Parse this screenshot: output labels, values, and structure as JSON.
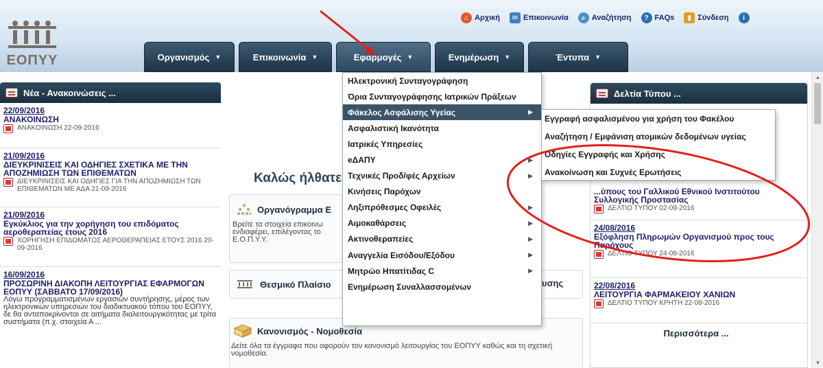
{
  "header": {
    "logo_text": "ΕΟΠΥΥ",
    "top_links": [
      {
        "label": "Αρχική",
        "icon": "home-icon"
      },
      {
        "label": "Επικοινωνία",
        "icon": "contact-icon"
      },
      {
        "label": "Αναζήτηση",
        "icon": "search-icon"
      },
      {
        "label": "FAQs",
        "icon": "help-icon"
      },
      {
        "label": "Σύνδεση",
        "icon": "login-icon"
      }
    ]
  },
  "nav": {
    "tabs": [
      {
        "label": "Οργανισμός",
        "chevron": "▼"
      },
      {
        "label": "Επικοινωνία",
        "chevron": "▼"
      },
      {
        "label": "Εφαρμογές",
        "chevron": "▼"
      },
      {
        "label": "Ενημέρωση",
        "chevron": "▼"
      },
      {
        "label": "Έντυπα",
        "chevron": "▼"
      }
    ]
  },
  "dropdown": {
    "items": [
      {
        "label": "Ηλεκτρονική Συνταγογράφηση",
        "arrow": ""
      },
      {
        "label": "Όρια Συνταγογράφησης Ιατρικών Πράξεων",
        "arrow": ""
      },
      {
        "label": "Φάκελος Ασφάλισης Υγείας",
        "arrow": "▶"
      },
      {
        "label": "Ασφαλιστική Ικανότητα",
        "arrow": ""
      },
      {
        "label": "Ιατρικές Υπηρεσίες",
        "arrow": ""
      },
      {
        "label": "eΔΑΠΥ",
        "arrow": "▶"
      },
      {
        "label": "Τεχνικές Προδ/φές Αρχείων",
        "arrow": "▶"
      },
      {
        "label": "Κινήσεις Παρόχων",
        "arrow": ""
      },
      {
        "label": "Ληξιπρόθεσμες Οφειλές",
        "arrow": "▶"
      },
      {
        "label": "Αιμοκαθάρσεις",
        "arrow": "▶"
      },
      {
        "label": "Ακτινοθεραπείες",
        "arrow": "▶"
      },
      {
        "label": "Αναγγελία Εισόδου/Εξόδου",
        "arrow": "▶"
      },
      {
        "label": "Μητρώο Ηπατίτιδας C",
        "arrow": "▶"
      },
      {
        "label": "Ενημέρωση Συναλλασσομένων",
        "arrow": ""
      }
    ],
    "submenu": [
      "Εγγραφή ασφαλισμένου για χρήση του Φακέλου",
      "Αναζήτηση / Εμφάνιση ατομικών δεδομένων υγείας",
      "Οδηγίες Εγγραφής και Χρήσης",
      "Ανακοίνωση και Συχνές Ερωτήσεις"
    ]
  },
  "news": {
    "title": "Νέα - Ανακοινώσεις ...",
    "items": [
      {
        "date": "22/09/2016",
        "title": "ΑΝΑΚΟΙΝΩΣΗ",
        "attachment": "ΑΝΑΚΟΙΝΩΣΗ 22-09-2016"
      },
      {
        "date": "21/09/2016",
        "title": "ΔΙΕΥΚΡΙΝΙΣΕΙΣ ΚΑΙ ΟΔΗΓΙΕΣ ΣΧΕΤΙΚΑ ΜΕ ΤΗΝ ΑΠΟΖΗΜΙΩΣΗ ΤΩΝ ΕΠΙΘΕΜΑΤΩΝ",
        "attachment": "ΔΙΕΥΚΡΙΝΙΣΕΙΣ ΚΑΙ ΟΔΗΓΙΕΣ ΓΙΑ ΤΗΝ ΑΠΟΖΗΜΙΩΣΗ ΤΩΝ ΕΠΙΘΕΜΑΤΩΝ ΜΕ ΑΔΑ 21-09-2016"
      },
      {
        "date": "21/09/2016",
        "title": "Εγκύκλιος για την χορήγηση του επιδόματος αεροθεραπείας έτους 2016",
        "attachment": "ΧΟΡΗΓΗΣΗ ΕΠΙΔΟΜΑΤΟΣ ΑΕΡΟΘΕΡΑΠΕΙΑΣ ΕΤΟΥΣ 2016 20-09-2016"
      },
      {
        "date": "16/09/2016",
        "title": "ΠΡΟΣΩΡΙΝΗ ΔΙΑΚΟΠΗ ΛΕΙΤΟΥΡΓΙΑΣ ΕΦΑΡΜΟΓΩΝ ΕΟΠΥΥ (ΣΑΒΒΑΤΟ 17/09/2016)",
        "desc": "Λόγω προγραμματισμένων εργασιών συντήρησης, μέρος των ηλεκτρονικών υπηρεσιών του διαδικτυακού τόπου του ΕΟΠΥΥ, δε θα ανταποκρίνονται σε αιτήματα διαλειτουργικότητας με τρίτα συστήματα (π.χ. στοιχεία Α ..."
      }
    ]
  },
  "center": {
    "welcome": "Καλώς ήλθατε",
    "cards": [
      {
        "title": "Οργανόγραμμα Ε",
        "text": "Βρείτε τα στοιχεία επικοινω ενδιαφέρει, επιλέγοντας το Ε.Ο.Π.Υ.Υ."
      },
      {
        "title": "Θεσμικό Πλαίσιο",
        "suffix": "υσης"
      },
      {
        "title": "Κανονισμός - Νομοθεσία",
        "text": "Δείτε όλα τα έγγραφα που αφορούν τον κανονισμό λειτουργίας του ΕΟΠΥΥ καθώς και τη σχετική νομοθεσία."
      }
    ]
  },
  "press": {
    "title": "Δελτία Τύπου ...",
    "items": [
      {
        "date": "",
        "title": "...ύπους του Γαλλικού Εθνικού Ινστιτούτου Συλλογικής Προστασίας",
        "attachment": "ΔΕΛΤΙΟ ΤΥΠΟΥ 02-09-2016"
      },
      {
        "date": "24/08/2016",
        "title": "Εξόφληση Πληρωμών Οργανισμού προς τους Παρόχους",
        "attachment": "ΔΕΛΤΙΟ ΤΥΠΟΥ 24-08-2016"
      },
      {
        "date": "22/08/2016",
        "title": "ΛΕΙΤΟΥΡΓΙΑ ΦΑΡΜΑΚΕΙΟΥ ΧΑΝΙΩΝ",
        "attachment": "ΔΕΛΤΙΟ ΤΥΠΟΥ ΚΡΗΤΗ 22-08-2016"
      }
    ],
    "more": "Περισσότερα ..."
  },
  "colors": {
    "nav_bg": "#1d3446",
    "highlight": "#3b5468",
    "link": "#1d1d6a",
    "annotation": "#e0201c"
  }
}
